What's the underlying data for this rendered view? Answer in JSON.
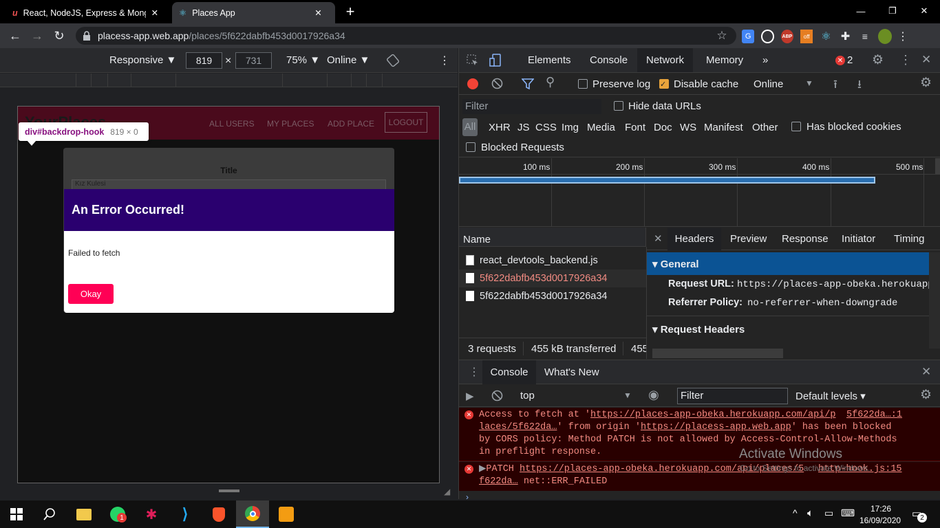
{
  "tabs": [
    {
      "title": "React, NodeJS, Express & Mongo",
      "close": "✕"
    },
    {
      "title": "Places App",
      "close": "✕"
    }
  ],
  "new_tab": "+",
  "window": {
    "min": "—",
    "max": "❐",
    "close": "✕"
  },
  "address": {
    "host": "placess-app.web.app",
    "path": "/places/5f622dabfb453d0017926a34"
  },
  "device": {
    "mode": "Responsive ▼",
    "width": "819",
    "times": "×",
    "height": "731",
    "zoom": "75% ▼",
    "network": "Online ▼",
    "more": "⋮"
  },
  "site": {
    "brand": "YourPlaces",
    "nav": [
      "ALL USERS",
      "MY PLACES",
      "ADD PLACE",
      "LOGOUT"
    ],
    "tooltip": {
      "tag": "div#backdrop-hook",
      "size": "819 × 0"
    },
    "form": {
      "title_label": "Title",
      "title_value": "Kız Kulesi"
    },
    "modal": {
      "header": "An Error Occurred!",
      "message": "Failed to fetch",
      "button": "Okay"
    }
  },
  "devtools": {
    "tabs": [
      "Elements",
      "Console",
      "Network",
      "Memory"
    ],
    "more_tabs": "»",
    "error_count": "2",
    "toolbar": {
      "preserve_log": "Preserve log",
      "disable_cache": "Disable cache",
      "throttle": "Online"
    },
    "filter_placeholder": "Filter",
    "hide_data_urls": "Hide data URLs",
    "types": [
      "All",
      "XHR",
      "JS",
      "CSS",
      "Img",
      "Media",
      "Font",
      "Doc",
      "WS",
      "Manifest",
      "Other"
    ],
    "has_blocked_cookies": "Has blocked cookies",
    "blocked_requests": "Blocked Requests",
    "timeline": [
      "100 ms",
      "200 ms",
      "300 ms",
      "400 ms",
      "500 ms"
    ],
    "name_col": "Name",
    "requests": [
      "react_devtools_backend.js",
      "5f622dabfb453d0017926a34",
      "5f622dabfb453d0017926a34"
    ],
    "detail_tabs": [
      "Headers",
      "Preview",
      "Response",
      "Initiator",
      "Timing"
    ],
    "general": "General",
    "request_url_label": "Request URL:",
    "request_url": "https://places-app-obeka.herokuapp",
    "referrer_label": "Referrer Policy:",
    "referrer": "no-referrer-when-downgrade",
    "request_headers": "Request Headers",
    "status": {
      "requests": "3 requests",
      "transferred": "455 kB transferred",
      "extra": "455"
    }
  },
  "console": {
    "tabs": [
      "Console",
      "What's New"
    ],
    "context": "top",
    "filter_placeholder": "Filter",
    "levels": "Default levels",
    "msg1": {
      "t1": "Access to fetch at '",
      "u1": "https://places-app-obeka.herokuapp.com/api/p",
      "src": "5f622da…:1",
      "l2a": "laces/5f622da…",
      "l2b": "' from origin '",
      "u2": "https://placess-app.web.app",
      "l2c": "' has been blocked",
      "l3": "by CORS policy: Method PATCH is not allowed by Access-Control-Allow-Methods",
      "l4": "in preflight response."
    },
    "msg2": {
      "method": "PATCH ",
      "u1": "https://places-app-obeka.herokuapp.com/api/places/5",
      "src": "http-hook.js:15",
      "l2a": "f622da…",
      "l2b": " net::ERR_FAILED"
    },
    "watermark": "Activate Windows",
    "watermark2": "Go to Settings to activate Windows."
  },
  "taskbar": {
    "time": "17:26",
    "date": "16/09/2020",
    "notif": "2",
    "whatsapp_badge": "1"
  }
}
